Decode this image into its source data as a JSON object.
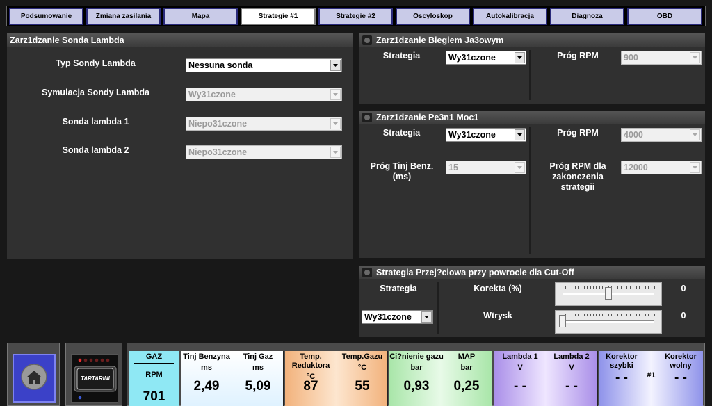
{
  "tabs": [
    {
      "label": "Podsumowanie"
    },
    {
      "label": "Zmiana zasilania"
    },
    {
      "label": "Mapa"
    },
    {
      "label": "Strategie #1"
    },
    {
      "label": "Strategie #2"
    },
    {
      "label": "Oscyloskop"
    },
    {
      "label": "Autokalibracja"
    },
    {
      "label": "Diagnoza"
    },
    {
      "label": "OBD"
    }
  ],
  "lambda": {
    "title": "Zarz1dzanie Sonda Lambda",
    "typ_label": "Typ Sondy Lambda",
    "typ_value": "Nessuna sonda",
    "sym_label": "Symulacja Sondy Lambda",
    "sym_value": "Wy31czone",
    "s1_label": "Sonda lambda 1",
    "s1_value": "Niepo31czone",
    "s2_label": "Sonda lambda 2",
    "s2_value": "Niepo31czone"
  },
  "bieg": {
    "title": "Zarz1dzanie Biegiem Ja3owym",
    "strategia_label": "Strategia",
    "strategia_value": "Wy31czone",
    "rpm_label": "Próg RPM",
    "rpm_value": "900"
  },
  "moc": {
    "title": "Zarz1dzanie Pe3n1 Moc1",
    "strategia_label": "Strategia",
    "strategia_value": "Wy31czone",
    "rpm_label": "Próg RPM",
    "rpm_value": "4000",
    "tinj_label": "Próg Tinj Benz. (ms)",
    "tinj_value": "15",
    "rpm_end_label": "Próg RPM dla zakonczenia strategii",
    "rpm_end_value": "12000"
  },
  "cutoff": {
    "title": "Strategia Przej?ciowa przy powrocie dla Cut-Off",
    "strategia_label": "Strategia",
    "strategia_value": "Wy31czone",
    "korekta_label": "Korekta (%)",
    "korekta_value": "0",
    "korekta_fraction": 0.5,
    "wtrysk_label": "Wtrysk",
    "wtrysk_value": "0",
    "wtrysk_fraction": 0.0
  },
  "logo": {
    "text": "TARTARINI"
  },
  "gauges": {
    "gaz": {
      "title": "GAZ",
      "label": "RPM",
      "value": "701"
    },
    "tinj_benz": {
      "label": "Tinj Benzyna",
      "unit": "ms",
      "value": "2,49"
    },
    "tinj_gaz": {
      "label": "Tinj Gaz",
      "unit": "ms",
      "value": "5,09"
    },
    "temp_red": {
      "label": "Temp. Reduktora",
      "unit": "°C",
      "value": "87"
    },
    "temp_gaz": {
      "label": "Temp.Gazu",
      "unit": "°C",
      "value": "55"
    },
    "cisnienie": {
      "label": "Ci?nienie gazu",
      "unit": "bar",
      "value": "0,93"
    },
    "map": {
      "label": "MAP",
      "unit": "bar",
      "value": "0,25"
    },
    "lambda1": {
      "label": "Lambda 1",
      "unit": "V",
      "value": "- -"
    },
    "lambda2": {
      "label": "Lambda 2",
      "unit": "V",
      "value": "- -"
    },
    "kor_szybki": {
      "label": "Korektor szybki",
      "value": "- -"
    },
    "kor_num": {
      "label": "#1"
    },
    "kor_wolny": {
      "label": "Korektor wolny",
      "value": "- -"
    }
  },
  "colors": {
    "gaz": "#8fe8f4",
    "tinj": "#ffffff",
    "temp": "#f7c9a0",
    "pressure": "#c8efc8",
    "lambda": "#c9b6f0",
    "korektor": "#b6b8f2"
  }
}
